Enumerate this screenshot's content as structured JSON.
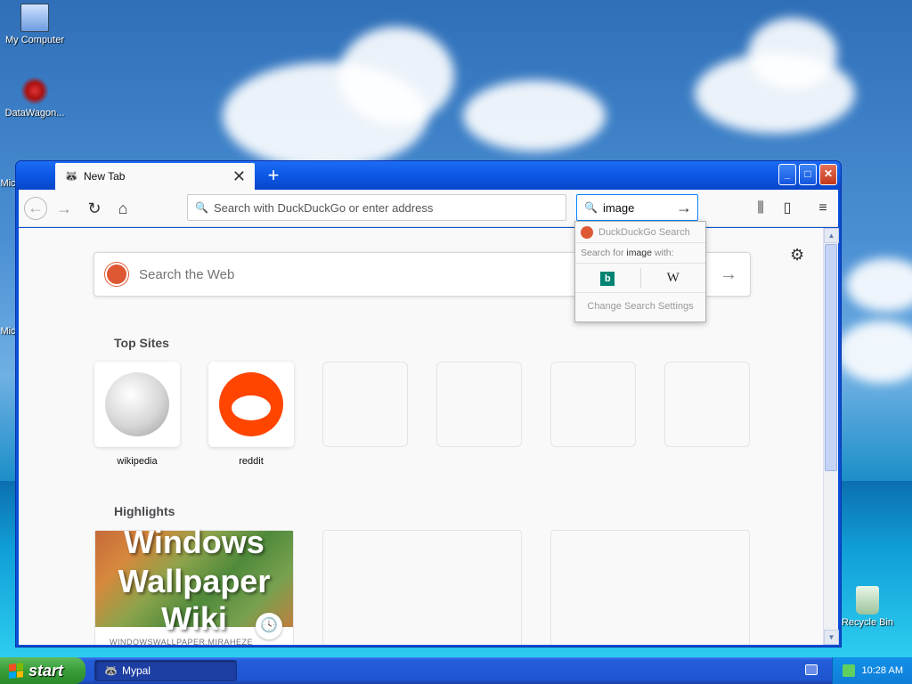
{
  "desktop": {
    "icons": [
      {
        "label": "My Computer",
        "icon": "computer-icon"
      },
      {
        "label": "DataWagon...",
        "icon": "datawagon-icon"
      },
      {
        "label": "Recycle Bin",
        "icon": "recycle-bin-icon"
      }
    ],
    "partial_labels": [
      "Mic",
      "Mic"
    ]
  },
  "browser": {
    "tab": {
      "title": "New Tab",
      "close": "✕"
    },
    "new_tab_button": "+",
    "url_placeholder": "Search with DuckDuckGo or enter address",
    "search_value": "image",
    "window_controls": {
      "minimize": "_",
      "maximize": "□",
      "close": "✕"
    }
  },
  "newtab_page": {
    "web_search_placeholder": "Search the Web",
    "top_sites_title": "Top Sites",
    "top_sites": [
      {
        "label": "wikipedia",
        "icon": "wikipedia-icon"
      },
      {
        "label": "reddit",
        "icon": "reddit-icon"
      },
      {
        "label": ""
      },
      {
        "label": ""
      },
      {
        "label": ""
      },
      {
        "label": ""
      }
    ],
    "highlights_title": "Highlights",
    "highlight_card": {
      "image_text_line1": "Windows",
      "image_text_line2": "Wallpaper",
      "image_text_line3": "Wiki",
      "domain": "WINDOWSWALLPAPER.MIRAHEZE"
    }
  },
  "search_popup": {
    "engine_header": "DuckDuckGo Search",
    "search_for_prefix": "Search for",
    "search_for_term": "image",
    "search_for_suffix": "with:",
    "engines": [
      {
        "name": "bing",
        "glyph": "b"
      },
      {
        "name": "wikipedia",
        "glyph": "W"
      }
    ],
    "change_settings": "Change Search Settings"
  },
  "taskbar": {
    "start_label": "start",
    "task_button_label": "Mypal",
    "clock": "10:28 AM"
  },
  "colors": {
    "xp_blue": "#0a54e0",
    "accent_focus": "#0a84ff",
    "ddg_orange": "#de5833",
    "reddit_orange": "#ff4500",
    "start_green": "#379e37"
  }
}
